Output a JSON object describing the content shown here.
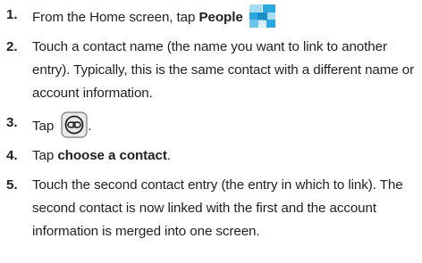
{
  "steps": [
    {
      "number": "1.",
      "before": "From the Home screen, tap ",
      "bold": "People",
      "icon": "people-app-icon",
      "after": ""
    },
    {
      "number": "2.",
      "text": "Touch a contact name (the name you want to link to another entry). Typically, this is the same contact with a different name or account information."
    },
    {
      "number": "3.",
      "before": "Tap ",
      "icon": "link-contact-icon",
      "after": "."
    },
    {
      "number": "4.",
      "before": "Tap ",
      "bold": "choose a contact",
      "after": "."
    },
    {
      "number": "5.",
      "text": "Touch the second contact entry (the entry in which to link). The second contact is now linked with the first and the account information is merged into one screen."
    }
  ],
  "colors": {
    "text": "#231f20",
    "icon_blue": "#29a9e0",
    "icon_light": "#a8dcf3",
    "link_icon_border": "#7a7a7a"
  }
}
